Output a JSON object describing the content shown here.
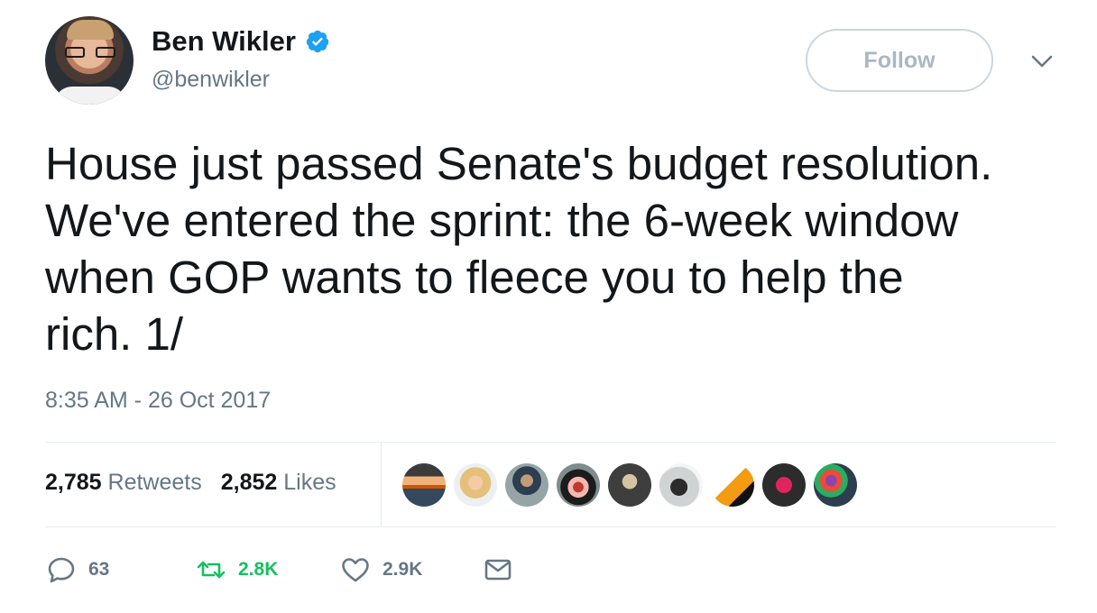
{
  "author": {
    "display_name": "Ben Wikler",
    "handle": "@benwikler",
    "verified": true,
    "avatar_icon": "profile-photo"
  },
  "follow_button": {
    "label": "Follow"
  },
  "menu": {
    "icon": "chevron-down-icon"
  },
  "tweet": {
    "text": "House just passed Senate's budget resolution.\nWe've entered the sprint: the 6-week window\nwhen GOP wants to fleece you to help the\nrich. 1/",
    "timestamp": "8:35 AM - 26 Oct 2017"
  },
  "stats": {
    "retweets_count": "2,785",
    "retweets_label": "Retweets",
    "likes_count": "2,852",
    "likes_label": "Likes"
  },
  "likers": [
    {
      "name": "liker-avatar-1"
    },
    {
      "name": "liker-avatar-2"
    },
    {
      "name": "liker-avatar-3"
    },
    {
      "name": "liker-avatar-4"
    },
    {
      "name": "liker-avatar-5"
    },
    {
      "name": "liker-avatar-6"
    },
    {
      "name": "liker-avatar-7"
    },
    {
      "name": "liker-avatar-8"
    },
    {
      "name": "liker-avatar-9"
    }
  ],
  "actions": {
    "reply_count": "63",
    "retweet_count": "2.8K",
    "like_count": "2.9K"
  },
  "colors": {
    "verified_blue": "#1da1f2",
    "retweet_green": "#17bf63",
    "muted": "#657786",
    "text": "#14171a"
  }
}
